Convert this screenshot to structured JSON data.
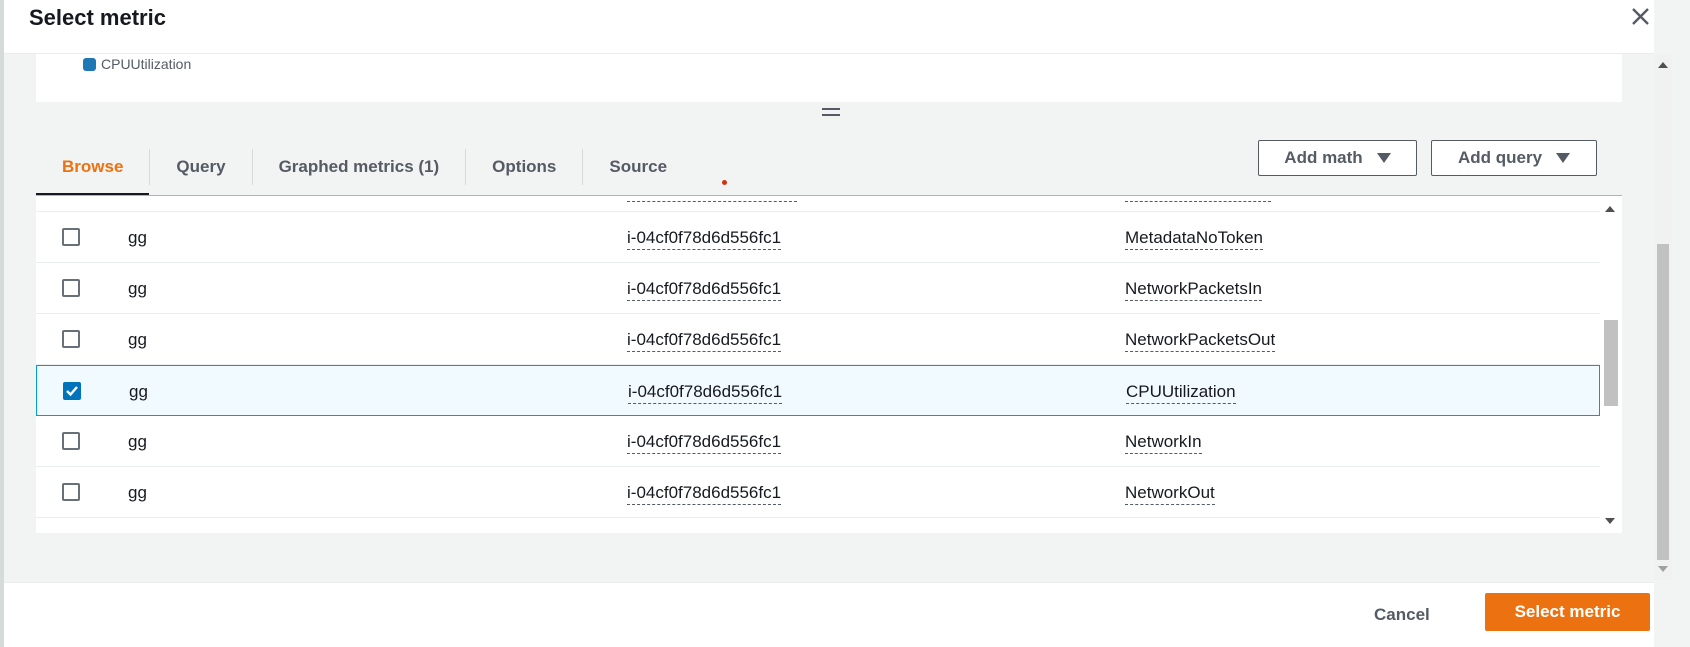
{
  "dialog": {
    "title": "Select metric"
  },
  "legend": {
    "items": [
      {
        "label": "CPUUtilization",
        "color": "#1f77b4"
      }
    ]
  },
  "tabs": [
    {
      "label": "Browse",
      "active": true
    },
    {
      "label": "Query",
      "active": false
    },
    {
      "label": "Graphed metrics (1)",
      "active": false
    },
    {
      "label": "Options",
      "active": false
    },
    {
      "label": "Source",
      "active": false
    }
  ],
  "actions": {
    "add_math": "Add math",
    "add_query": "Add query"
  },
  "rows": [
    {
      "checked": false,
      "name": "gg",
      "instance_id": "i-04cf0f78d6d556fc1",
      "metric": "MetadataNoToken"
    },
    {
      "checked": false,
      "name": "gg",
      "instance_id": "i-04cf0f78d6d556fc1",
      "metric": "NetworkPacketsIn"
    },
    {
      "checked": false,
      "name": "gg",
      "instance_id": "i-04cf0f78d6d556fc1",
      "metric": "NetworkPacketsOut"
    },
    {
      "checked": true,
      "name": "gg",
      "instance_id": "i-04cf0f78d6d556fc1",
      "metric": "CPUUtilization"
    },
    {
      "checked": false,
      "name": "gg",
      "instance_id": "i-04cf0f78d6d556fc1",
      "metric": "NetworkIn"
    },
    {
      "checked": false,
      "name": "gg",
      "instance_id": "i-04cf0f78d6d556fc1",
      "metric": "NetworkOut"
    }
  ],
  "footer": {
    "cancel_label": "Cancel",
    "submit_label": "Select metric"
  },
  "colors": {
    "accent": "#ec7211",
    "selected_border": "#00a1c9",
    "checkbox_checked": "#0073bb"
  }
}
